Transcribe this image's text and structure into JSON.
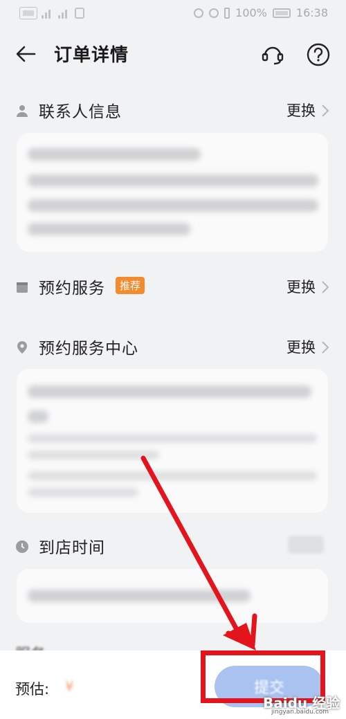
{
  "status_bar": {
    "battery": "100%",
    "time": "16:38"
  },
  "header": {
    "title": "订单详情"
  },
  "sections": {
    "contact": {
      "title": "联系人信息",
      "change_label": "更换"
    },
    "service": {
      "title": "预约服务",
      "badge": "推荐",
      "change_label": "更换"
    },
    "center": {
      "title": "预约服务中心",
      "change_label": "更换"
    },
    "time": {
      "title": "到店时间"
    },
    "partial": {
      "title": "服务"
    }
  },
  "bottom_bar": {
    "estimate_label": "预估:",
    "price": "¥",
    "submit_label": "提交"
  },
  "watermark": {
    "brand": "Baidu 经验",
    "url": "jingyan.baidu.com"
  },
  "colors": {
    "accent": "#f28a2e",
    "submit": "#a9c2f0",
    "annotation": "#e3141b"
  }
}
